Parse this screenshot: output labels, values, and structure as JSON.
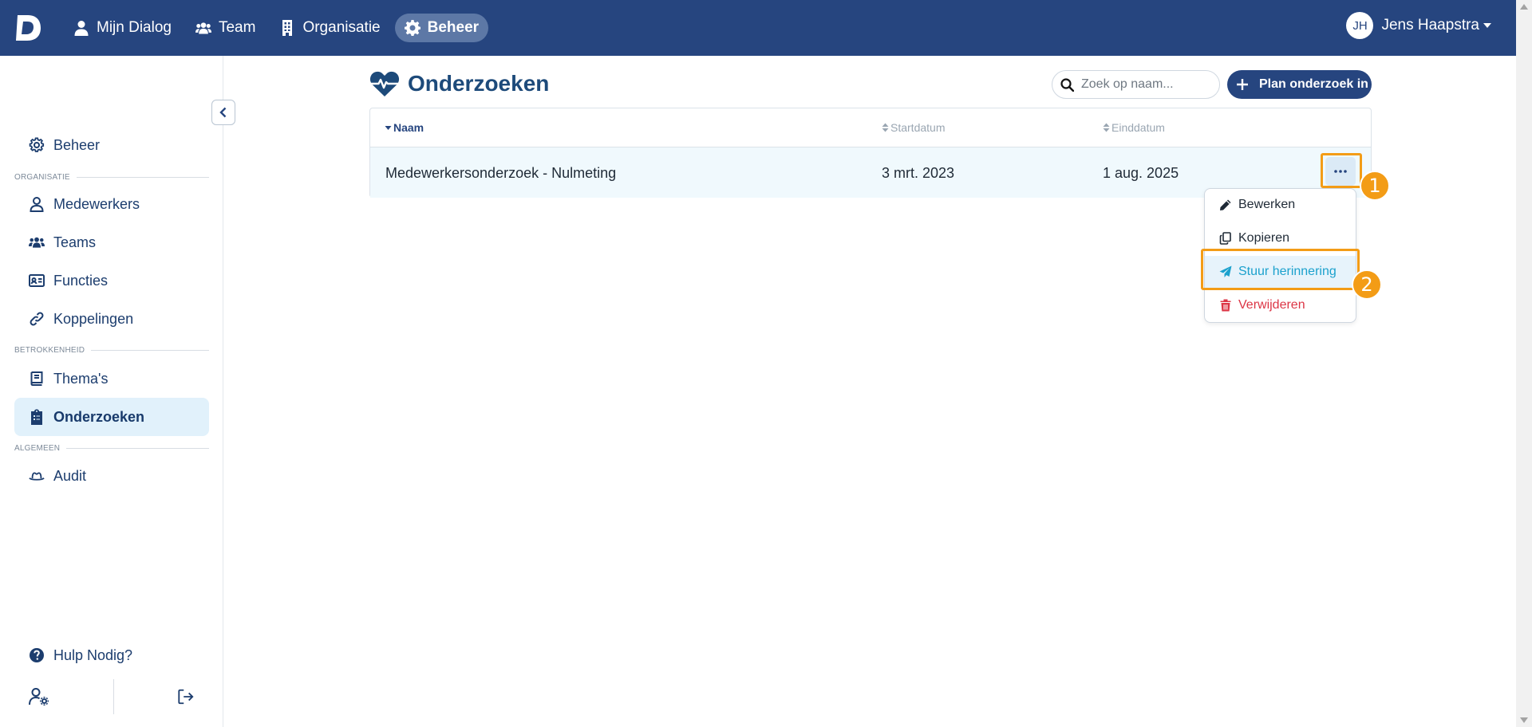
{
  "nav": {
    "items": [
      {
        "label": "Mijn Dialog",
        "icon": "user-icon"
      },
      {
        "label": "Team",
        "icon": "users-icon"
      },
      {
        "label": "Organisatie",
        "icon": "building-icon"
      },
      {
        "label": "Beheer",
        "icon": "gear-icon",
        "active": true
      }
    ],
    "user": {
      "initials": "JH",
      "name": "Jens Haapstra"
    }
  },
  "sidebar": {
    "top_item": {
      "label": "Beheer",
      "icon": "gear-icon"
    },
    "sections": [
      {
        "title": "ORGANISATIE",
        "items": [
          {
            "label": "Medewerkers",
            "icon": "user-icon"
          },
          {
            "label": "Teams",
            "icon": "users-icon"
          },
          {
            "label": "Functies",
            "icon": "id-card-icon"
          },
          {
            "label": "Koppelingen",
            "icon": "link-icon"
          }
        ]
      },
      {
        "title": "BETROKKENHEID",
        "items": [
          {
            "label": "Thema's",
            "icon": "book-icon"
          },
          {
            "label": "Onderzoeken",
            "icon": "clipboard-icon",
            "active": true
          }
        ]
      },
      {
        "title": "ALGEMEEN",
        "items": [
          {
            "label": "Audit",
            "icon": "hat-icon"
          }
        ]
      }
    ],
    "help_label": "Hulp Nodig?"
  },
  "main": {
    "title": "Onderzoeken",
    "search_placeholder": "Zoek op naam...",
    "plan_button": "Plan onderzoek in",
    "columns": [
      "Naam",
      "Startdatum",
      "Einddatum"
    ],
    "rows": [
      {
        "naam": "Medewerkersonderzoek - Nulmeting",
        "start": "3 mrt. 2023",
        "eind": "1 aug. 2025"
      }
    ]
  },
  "menu": {
    "items": [
      {
        "label": "Bewerken",
        "icon": "pencil-icon"
      },
      {
        "label": "Kopieren",
        "icon": "copy-icon"
      },
      {
        "label": "Stuur herinnering",
        "icon": "paper-plane-icon"
      },
      {
        "label": "Verwijderen",
        "icon": "trash-icon"
      }
    ]
  },
  "annotations": {
    "step1": "1",
    "step2": "2"
  },
  "colors": {
    "primary": "#26457f",
    "accent": "#1ba1cd",
    "danger": "#dc3545",
    "highlight": "#f39c16"
  }
}
